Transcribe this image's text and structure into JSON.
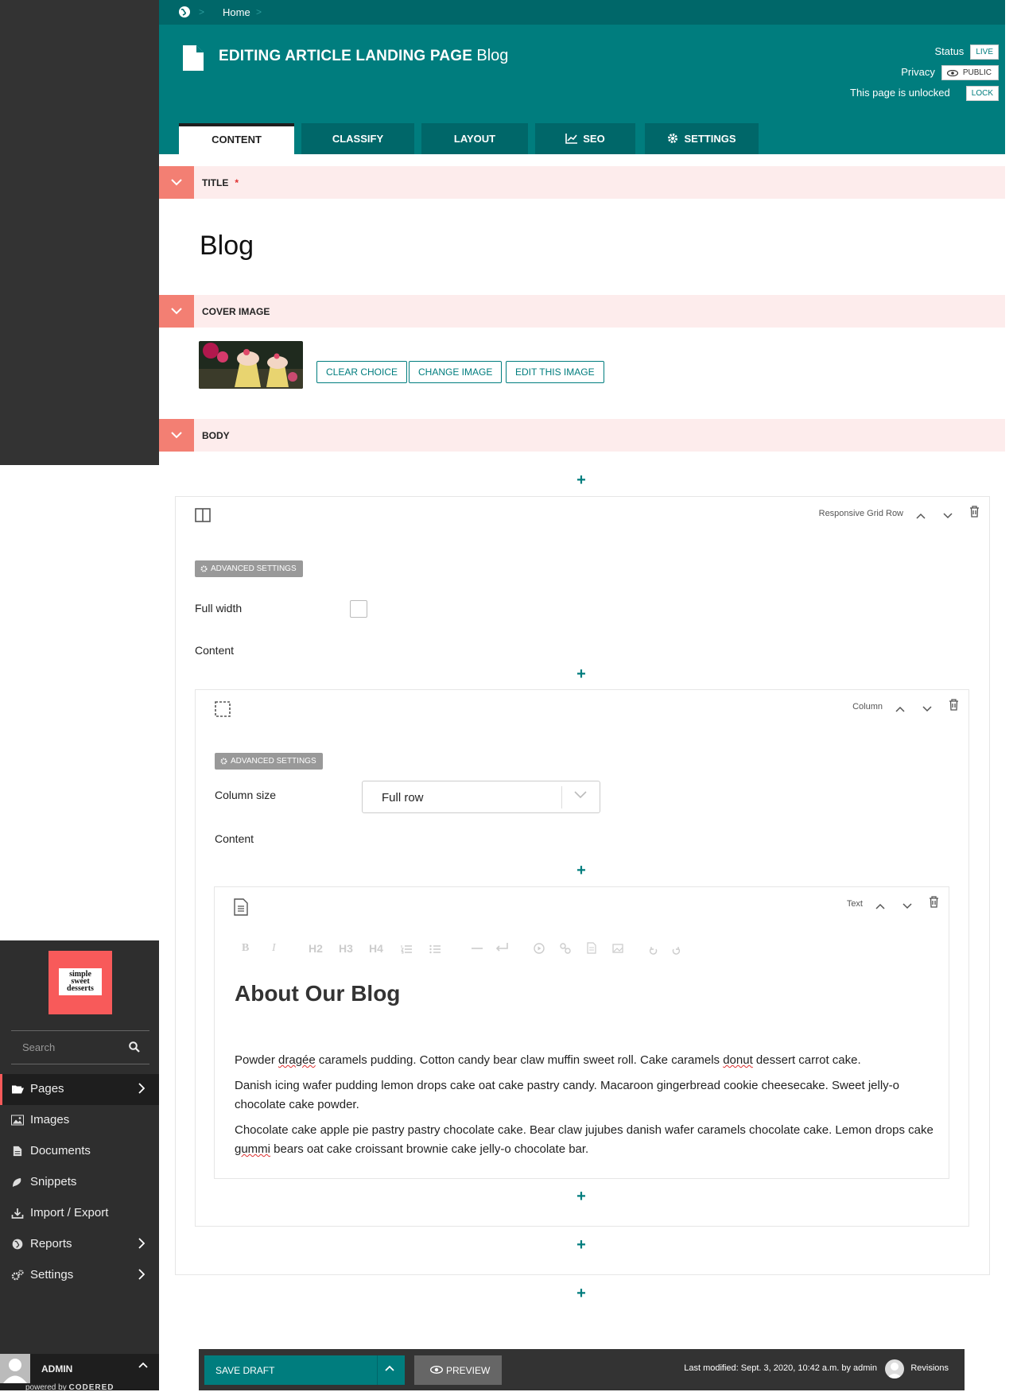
{
  "header": {
    "breadcrumb_home": "Home",
    "title_bold": "EDITING ARTICLE LANDING PAGE",
    "title_page": "Blog",
    "status_label": "Status",
    "status_value": "LIVE",
    "privacy_label": "Privacy",
    "privacy_value": "PUBLIC",
    "lock_text": "This page is unlocked",
    "lock_button": "LOCK",
    "tabs": [
      "CONTENT",
      "CLASSIFY",
      "LAYOUT",
      "SEO",
      "SETTINGS"
    ]
  },
  "sections": {
    "title_label": "TITLE",
    "title_required": "*",
    "title_value": "Blog",
    "cover_label": "COVER IMAGE",
    "cover_buttons": [
      "CLEAR CHOICE",
      "CHANGE IMAGE",
      "EDIT THIS IMAGE"
    ],
    "body_label": "BODY"
  },
  "grid_row": {
    "type": "Responsive Grid Row",
    "advanced": "ADVANCED SETTINGS",
    "full_width_label": "Full width",
    "content_label": "Content"
  },
  "column": {
    "type": "Column",
    "advanced": "ADVANCED SETTINGS",
    "size_label": "Column size",
    "size_value": "Full row",
    "content_label": "Content"
  },
  "text_block": {
    "type": "Text",
    "toolbar": [
      "B",
      "I",
      "H2",
      "H3",
      "H4"
    ],
    "heading": "About Our Blog",
    "p1_a": "Powder ",
    "p1_b": "dragée",
    "p1_c": " caramels pudding. Cotton candy bear claw muffin sweet roll. Cake caramels ",
    "p1_d": "donut",
    "p1_e": " dessert carrot cake.",
    "p2": "Danish  icing wafer pudding lemon drops cake oat cake pastry candy. Macaroon  gingerbread cookie cheesecake. Sweet jelly-o chocolate cake powder.",
    "p3_a": "Chocolate  cake apple pie pastry pastry chocolate cake. Bear claw jujubes danish  wafer caramels chocolate cake. Lemon drops cake ",
    "p3_b": "gummi",
    "p3_c": " bears oat cake  croissant brownie cake jelly-o chocolate bar."
  },
  "sidebar": {
    "logo_lines": [
      "simple",
      "sweet",
      "desserts"
    ],
    "search_placeholder": "Search",
    "items": [
      {
        "label": "Pages",
        "icon": "folder-open-icon"
      },
      {
        "label": "Images",
        "icon": "image-icon"
      },
      {
        "label": "Documents",
        "icon": "doc-icon"
      },
      {
        "label": "Snippets",
        "icon": "snippet-icon"
      },
      {
        "label": "Import / Export",
        "icon": "download-icon"
      },
      {
        "label": "Reports",
        "icon": "globe-icon"
      },
      {
        "label": "Settings",
        "icon": "cogs-icon"
      }
    ],
    "admin_name": "ADMIN",
    "powered_by": "powered by",
    "brand": "CODERED"
  },
  "footer": {
    "save_draft": "SAVE DRAFT",
    "preview": "PREVIEW",
    "last_modified": "Last modified: Sept. 3, 2020, 10:42 a.m. by admin",
    "revisions": "Revisions"
  },
  "colors": {
    "teal": "#007d7e",
    "teal_dark": "#006769",
    "coral": "#f37f73",
    "section_bg": "#fdecec",
    "sidebar": "#333333"
  }
}
